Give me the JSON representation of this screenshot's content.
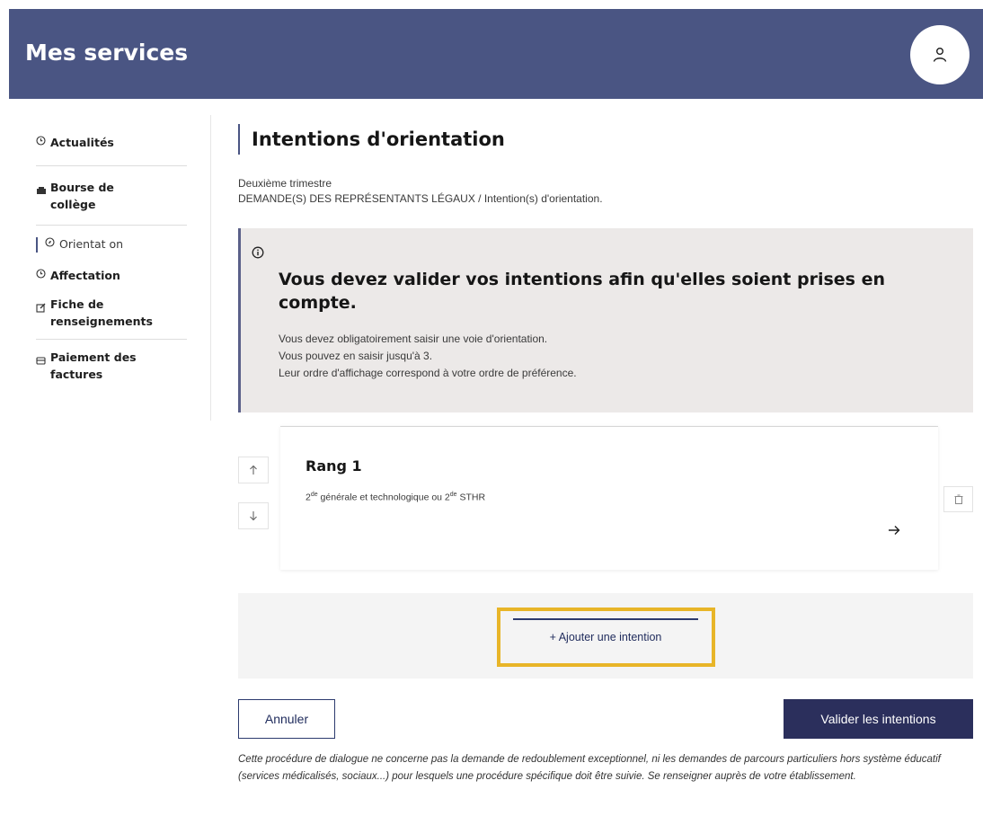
{
  "header": {
    "title": "Mes services",
    "avatar_icon": "user-icon"
  },
  "sidebar": {
    "items": [
      {
        "label": "Actualités",
        "icon": "clock-icon"
      },
      {
        "label": "Bourse de collège",
        "icon": "money-icon"
      },
      {
        "label": "Orientat on",
        "icon": "compass-icon",
        "active": true
      },
      {
        "label": "Affectation",
        "icon": "clock-icon"
      },
      {
        "label": "Fiche de renseignements",
        "icon": "edit-icon"
      },
      {
        "label": "Paiement des factures",
        "icon": "card-icon"
      }
    ]
  },
  "main": {
    "title": "Intentions d'orientation",
    "meta_line1": "Deuxième trimestre",
    "meta_line2": "DEMANDE(S) DES REPRÉSENTANTS LÉGAUX / Intention(s) d'orientation."
  },
  "alert": {
    "title": "Vous devez valider vos intentions afin qu'elles soient prises en compte.",
    "line1": "Vous devez obligatoirement saisir une voie d'orientation.",
    "line2": "Vous pouvez en saisir jusqu'à 3.",
    "line3": "Leur ordre d'affichage correspond à votre ordre de préférence."
  },
  "intention": {
    "rank_label": "Rang 1",
    "desc_num1": "2",
    "desc_sup1": "de",
    "desc_mid": " générale et technologique ou ",
    "desc_num2": "2",
    "desc_sup2": "de",
    "desc_end": " STHR"
  },
  "add_button": {
    "label": "+ Ajouter une intention"
  },
  "actions": {
    "cancel_label": "Annuler",
    "validate_label": "Valider les intentions"
  },
  "footnote": "Cette procédure de dialogue ne concerne pas la demande de redoublement exceptionnel, ni les demandes de parcours particuliers hors système éducatif (services médicalisés, sociaux...) pour lesquels une procédure spécifique doit être suivie. Se renseigner auprès de votre établissement.",
  "colors": {
    "header_bg": "#4a5583",
    "accent": "#2b2f5c",
    "highlight": "#e8b528",
    "alert_bg": "#ece9e8"
  }
}
